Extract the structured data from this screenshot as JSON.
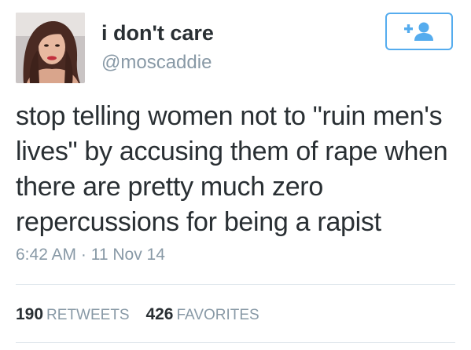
{
  "user": {
    "display_name": "i don't care",
    "handle": "@moscaddie"
  },
  "follow_button": {
    "icon": "follow-user-icon",
    "accent_color": "#55acee"
  },
  "tweet": {
    "lines": [
      "stop telling women not to \"ruin men's",
      "lives\" by accusing them of rape when",
      "there are pretty much zero",
      "repercussions for being a rapist"
    ],
    "timestamp": "6:42 AM · 11 Nov 14"
  },
  "stats": {
    "retweets_count": "190",
    "retweets_label": "RETWEETS",
    "favorites_count": "426",
    "favorites_label": "FAVORITES"
  }
}
